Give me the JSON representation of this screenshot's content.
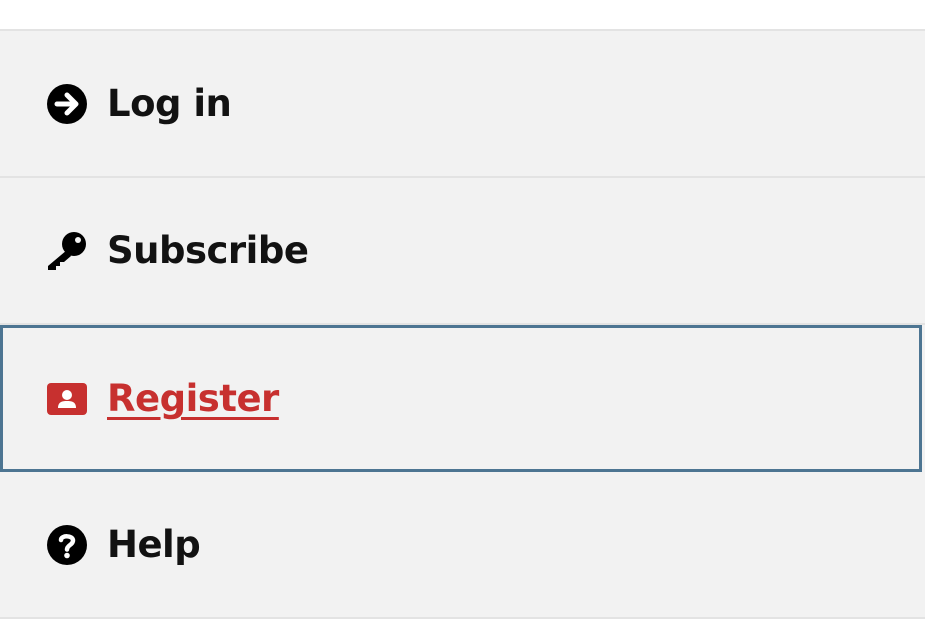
{
  "menu": {
    "items": [
      {
        "label": "Log in",
        "icon": "arrow-right-circle-icon"
      },
      {
        "label": "Subscribe",
        "icon": "key-icon"
      },
      {
        "label": "Register",
        "icon": "user-card-icon",
        "state": "focused",
        "color": "#c7302f"
      },
      {
        "label": "Help",
        "icon": "question-circle-icon"
      }
    ]
  },
  "colors": {
    "background": "#f2f2f2",
    "divider": "#e3e3e3",
    "text": "#121212",
    "accent": "#c7302f",
    "focus_outline": "#4d7592"
  }
}
